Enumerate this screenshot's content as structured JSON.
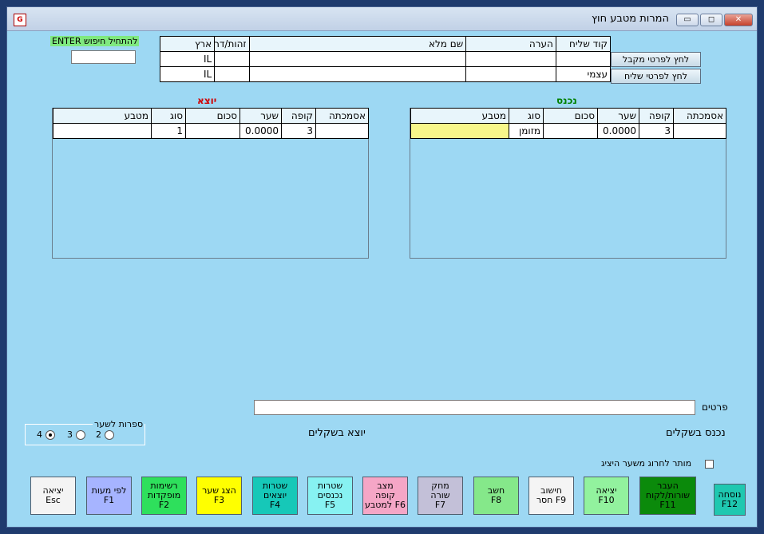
{
  "window": {
    "title": "המרות מטבע חוץ",
    "min_label": "▭",
    "max_label": "◻",
    "close_label": "✕"
  },
  "search": {
    "label": "ENTER להתחיל חיפוש",
    "value": ""
  },
  "party_table": {
    "headers": [
      "ארץ",
      "זהות/דרכון",
      "שם מלא",
      "הערה",
      "קוד שליח"
    ],
    "rows": [
      [
        "IL",
        "",
        "",
        "",
        ""
      ],
      [
        "IL",
        "",
        "",
        "",
        "עצמי"
      ]
    ]
  },
  "party_buttons": {
    "receiver": "לחץ לפרטי מקבל",
    "sender": "לחץ לפרטי שליח"
  },
  "incoming": {
    "title": "נכנס",
    "headers": [
      "מטבע",
      "סוג",
      "סכום",
      "שער",
      "קופה",
      "אסמכתה"
    ],
    "row": [
      "",
      "מזומן",
      "",
      "0.0000",
      "3",
      ""
    ]
  },
  "outgoing": {
    "title": "יוצא",
    "headers": [
      "מטבע",
      "סוג",
      "סכום",
      "שער",
      "קופה",
      "אסמכתה"
    ],
    "row": [
      "",
      "1",
      "",
      "0.0000",
      "3",
      ""
    ]
  },
  "details": {
    "label": "פרטים",
    "value": ""
  },
  "totals": {
    "incoming_label": "נכנס בשקלים",
    "outgoing_label": "יוצא בשקלים"
  },
  "digits": {
    "label": "ספרות לשער",
    "options": [
      "2",
      "3",
      "4"
    ],
    "selected": "4"
  },
  "allow_deviation": {
    "label": "מותר לחרוג משער היציג",
    "checked": false
  },
  "fkeys": [
    {
      "line1": "נוסחה",
      "line2": "F12",
      "color": "#1fc8b0"
    },
    {
      "line1": "העבר",
      "line2": "שורות/לקוח",
      "line3": "F11",
      "color": "#0b8a0b"
    },
    {
      "line1": "יציאה",
      "line2": "F10",
      "color": "#92f29e"
    },
    {
      "line1": "חישוב",
      "line2": "חסר F9",
      "color": "#f4f4f4"
    },
    {
      "line1": "חשב",
      "line2": "F8",
      "color": "#85e88a"
    },
    {
      "line1": "מחק",
      "line2": "שורה",
      "line3": "F7",
      "color": "#c3c0d8"
    },
    {
      "line1": "מצב",
      "line2": "קופה",
      "line3": "למטבע F6",
      "color": "#f5a6c6"
    },
    {
      "line1": "שטרות",
      "line2": "נכנסים",
      "line3": "F5",
      "color": "#87f2f2"
    },
    {
      "line1": "שטרות",
      "line2": "יוצאים",
      "line3": "F4",
      "color": "#16c8b8"
    },
    {
      "line1": "הצג שער",
      "line2": "F3",
      "color": "#ffff00"
    },
    {
      "line1": "רשימות",
      "line2": "מופקדות",
      "line3": "F2",
      "color": "#2ee05c"
    },
    {
      "line1": "לפי מעות",
      "line2": "F1",
      "color": "#a6b4ff"
    },
    {
      "line1": "יציאה",
      "line2": "Esc",
      "color": "#f4f4f4"
    }
  ]
}
